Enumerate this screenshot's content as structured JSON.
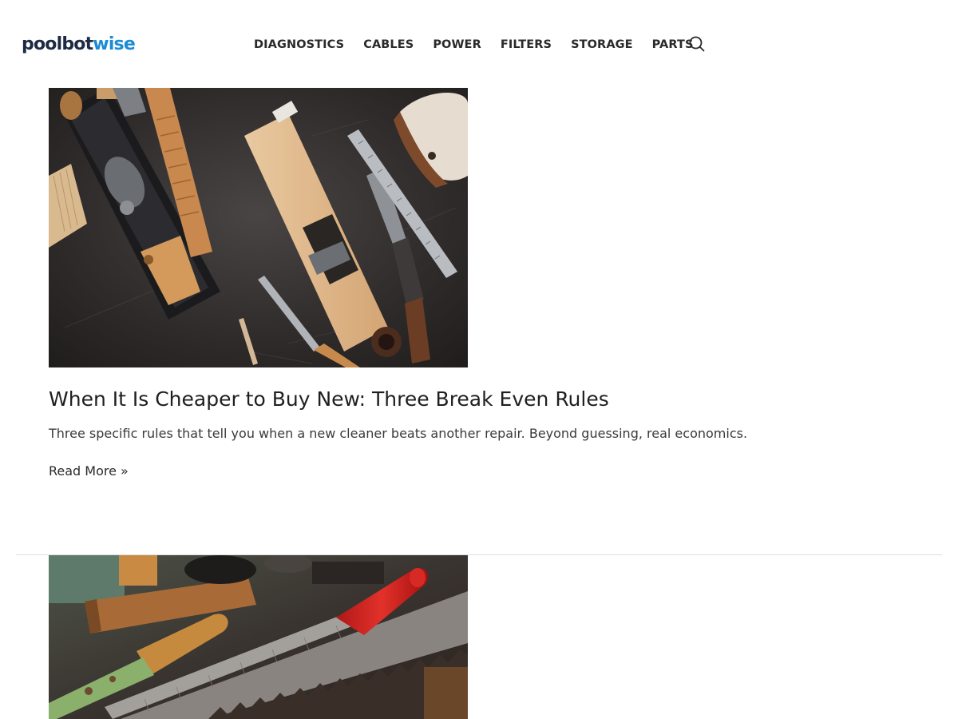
{
  "header": {
    "logo_part1": "poolbot",
    "logo_part2": "wise",
    "brand_dark": "#1e2a44",
    "brand_blue": "#1c8bd4",
    "nav": [
      {
        "label": "DIAGNOSTICS"
      },
      {
        "label": "CABLES"
      },
      {
        "label": "POWER"
      },
      {
        "label": "FILTERS"
      },
      {
        "label": "STORAGE"
      },
      {
        "label": "PARTS"
      }
    ],
    "search_icon": "search-icon"
  },
  "posts": [
    {
      "thumbnail": "woodworking-hand-tools-photo",
      "title": "When It Is Cheaper to Buy New: Three Break Even Rules",
      "excerpt": "Three specific rules that tell you when a new cleaner beats another repair. Beyond guessing, real economics.",
      "read_more": "Read More »"
    },
    {
      "thumbnail": "file-and-saw-tools-photo"
    }
  ]
}
